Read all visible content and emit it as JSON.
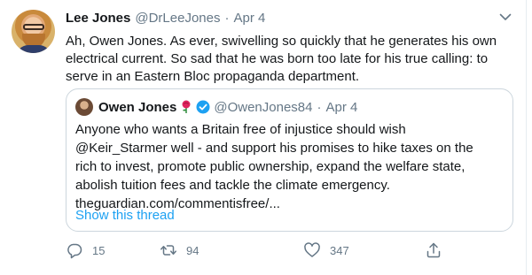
{
  "tweet": {
    "author_name": "Lee Jones",
    "author_handle": "@DrLeeJones",
    "separator": "·",
    "date": "Apr 4",
    "text": "Ah, Owen Jones. As ever, swivelling so quickly that he generates his own electrical current. So sad that he was born too late for his true calling: to serve in an Eastern Bloc propaganda department."
  },
  "quoted": {
    "author_name": "Owen Jones",
    "author_handle": "@OwenJones84",
    "separator": "·",
    "date": "Apr 4",
    "text_lines": [
      "Anyone who wants a Britain free of injustice should wish",
      "@Keir_Starmer well - and support his promises to hike taxes on the",
      "rich to invest, promote public ownership, expand the welfare state,",
      "abolish tuition fees and tackle the climate emergency.",
      "theguardian.com/commentisfree/..."
    ],
    "show_thread": "Show this thread"
  },
  "actions": {
    "replies": "15",
    "retweets": "94",
    "likes": "347"
  },
  "icons": {
    "reply": "reply-icon",
    "retweet": "retweet-icon",
    "like": "heart-icon",
    "share": "share-icon",
    "menu": "chevron-down-icon",
    "verified": "verified-badge-icon",
    "rose": "rose-icon"
  },
  "colors": {
    "text": "#14171a",
    "muted": "#657786",
    "link": "#1da1f2",
    "border": "#ccd6dd",
    "verified": "#1da1f2",
    "rose": "#e0245e"
  }
}
